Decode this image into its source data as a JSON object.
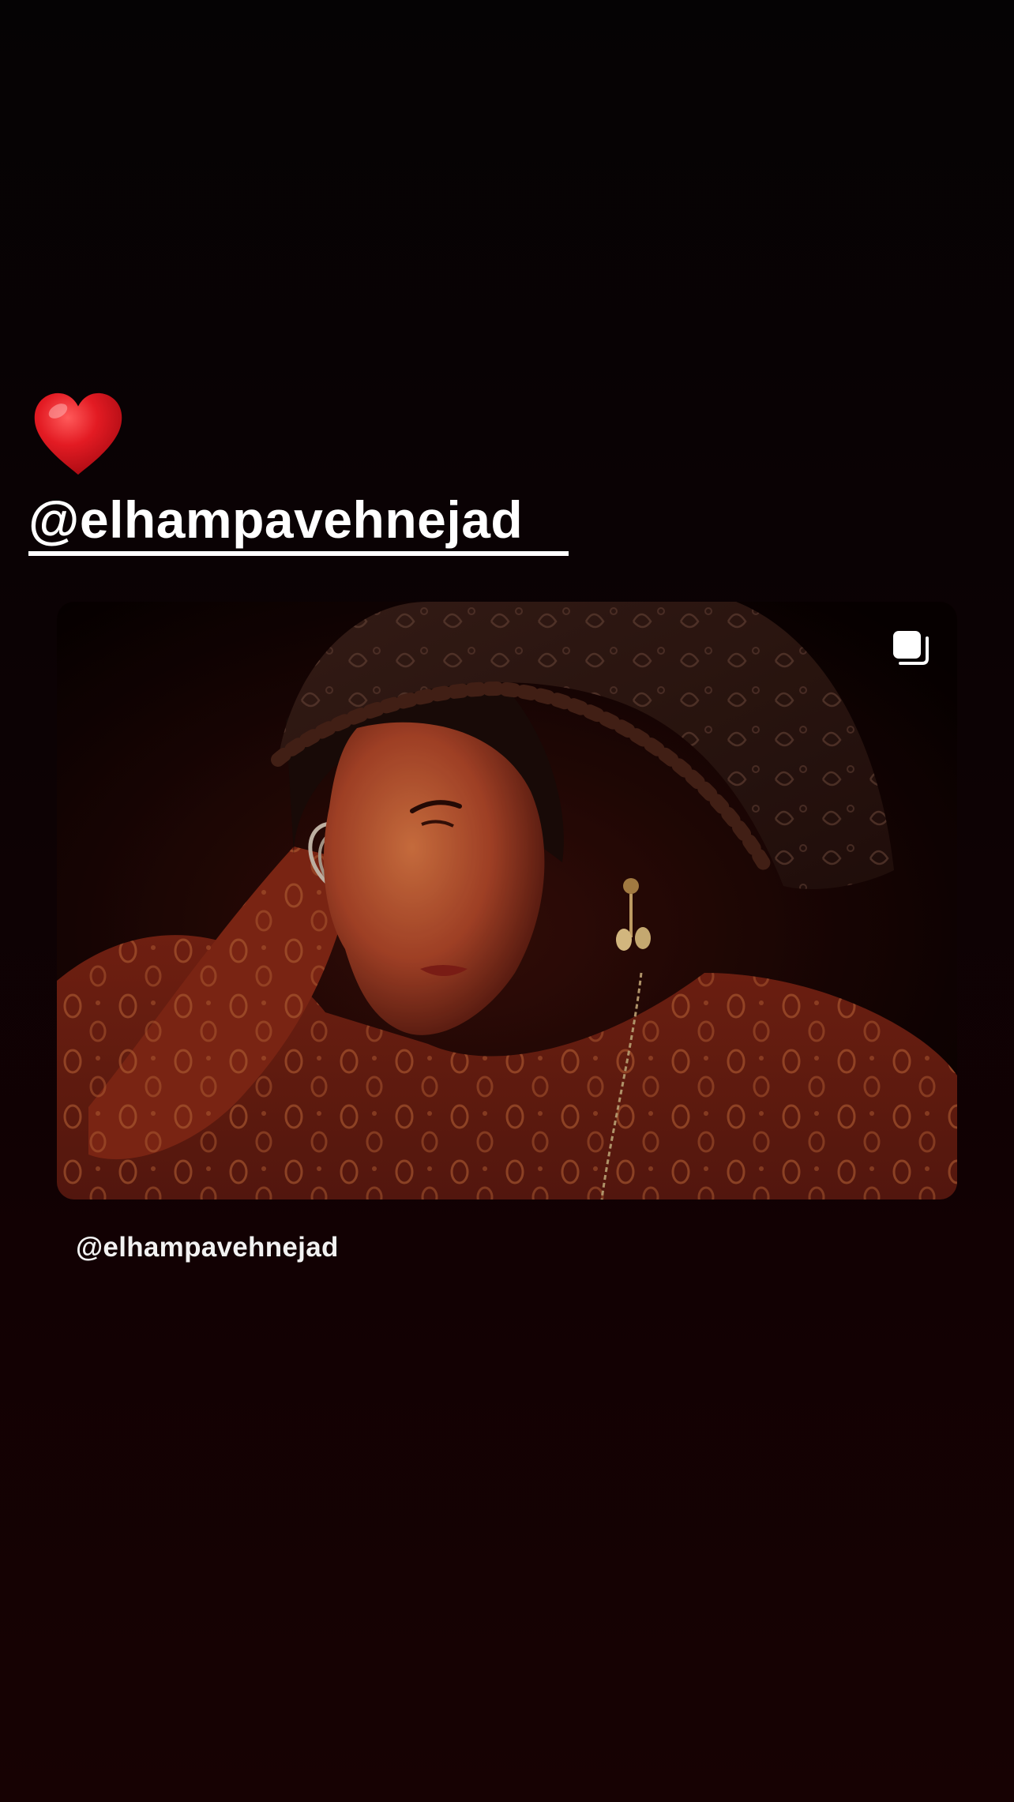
{
  "story": {
    "sticker": "heart-emoji",
    "mention": "@elhampavehnejad",
    "post": {
      "image": "portrait-woman-headscarf-photo",
      "badge_icon": "carousel-icon",
      "caption": "@elhampavehnejad"
    }
  },
  "colors": {
    "background_top": "#050304",
    "background_bottom": "#170203",
    "heart": "#e0151d",
    "text": "#ffffff"
  }
}
